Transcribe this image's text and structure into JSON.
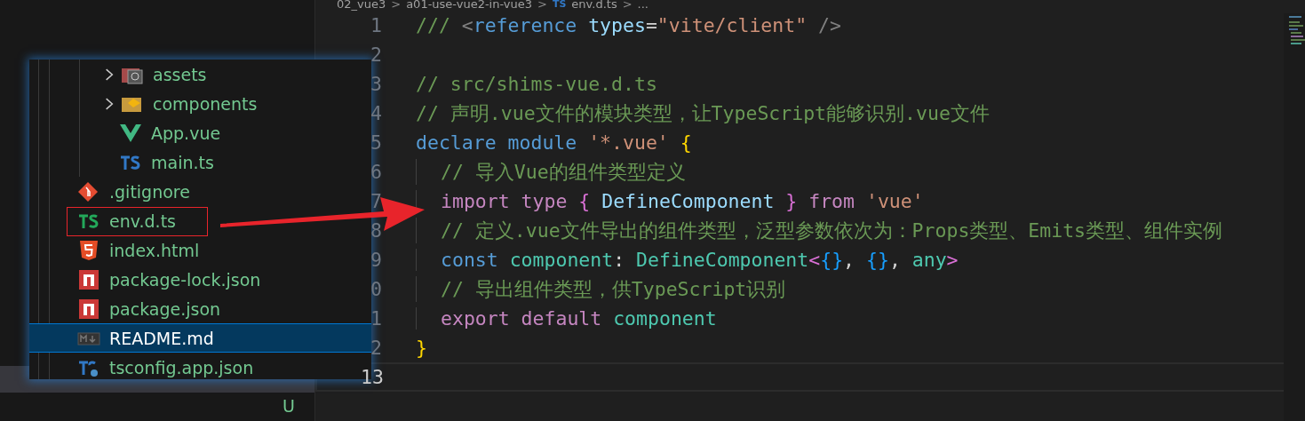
{
  "breadcrumb": [
    {
      "kind": "crumb",
      "text": "02_vue3"
    },
    {
      "kind": "sep",
      "text": ">"
    },
    {
      "kind": "crumb",
      "text": "a01-use-vue2-in-vue3"
    },
    {
      "kind": "sep",
      "text": ">"
    },
    {
      "kind": "badge",
      "text": "TS"
    },
    {
      "kind": "crumb",
      "text": "env.d.ts"
    },
    {
      "kind": "sep",
      "text": ">"
    },
    {
      "kind": "crumb",
      "text": "..."
    }
  ],
  "sidebar": {
    "git_badges": [
      "U"
    ]
  },
  "file_popup": {
    "items": [
      {
        "kind": "group",
        "children": [
          {
            "kind": "assets-folder",
            "label": "assets",
            "selected": false
          },
          {
            "kind": "components-folder",
            "label": "components",
            "selected": false
          },
          {
            "kind": "vue",
            "label": "App.vue",
            "selected": false
          },
          {
            "kind": "ts",
            "label": "main.ts",
            "selected": false
          }
        ]
      },
      {
        "kind": "git",
        "label": ".gitignore",
        "selected": false
      },
      {
        "kind": "ts-green",
        "label": "env.d.ts",
        "selected": false,
        "annotated": true
      },
      {
        "kind": "html",
        "label": "index.html",
        "selected": false
      },
      {
        "kind": "npm",
        "label": "package-lock.json",
        "selected": false
      },
      {
        "kind": "npm",
        "label": "package.json",
        "selected": false
      },
      {
        "kind": "md",
        "label": "README.md",
        "selected": true
      },
      {
        "kind": "ts-config",
        "label": "tsconfig.app.json",
        "selected": false
      }
    ]
  },
  "editor": {
    "lines": [
      {
        "number": "1",
        "indent": false,
        "current": false,
        "tokens": [
          {
            "t": "///",
            "color": "#6a9955"
          },
          {
            "t": " <",
            "color": "#808080"
          },
          {
            "t": "reference",
            "color": "#569cd6"
          },
          {
            "t": " types",
            "color": "#9cdcfe"
          },
          {
            "t": "=",
            "color": "#d4d4d4"
          },
          {
            "t": "\"vite/client\"",
            "color": "#ce9178"
          },
          {
            "t": " />",
            "color": "#808080"
          }
        ]
      },
      {
        "number": "2",
        "indent": false,
        "current": false
      },
      {
        "number": "3",
        "indent": false,
        "current": false,
        "tokens": [
          {
            "t": "// src/shims-vue.d.ts",
            "color": "#6a9955"
          }
        ]
      },
      {
        "number": "4",
        "indent": false,
        "current": false,
        "tokens": [
          {
            "t": "// 声明.vue文件的模块类型，让TypeScript能够识别.vue文件",
            "color": "#6a9955"
          }
        ]
      },
      {
        "number": "5",
        "indent": false,
        "current": false,
        "tokens": [
          {
            "t": "declare module",
            "color": "#569cd6"
          },
          {
            "t": " '*.vue'",
            "color": "#ce9178"
          },
          {
            "t": " {",
            "color": "#ffd700"
          }
        ]
      },
      {
        "number": "6",
        "indent": true,
        "current": false,
        "tokens": [
          {
            "t": "// 导入Vue的组件类型定义",
            "color": "#6a9955"
          }
        ]
      },
      {
        "number": "7",
        "indent": true,
        "current": false,
        "tokens": [
          {
            "t": "import type",
            "color": "#c586c0"
          },
          {
            "t": " {",
            "color": "#da70d6"
          },
          {
            "t": " DefineComponent",
            "color": "#9cdcfe"
          },
          {
            "t": " }",
            "color": "#da70d6"
          },
          {
            "t": " from",
            "color": "#c586c0"
          },
          {
            "t": " 'vue'",
            "color": "#ce9178"
          }
        ]
      },
      {
        "number": "8",
        "indent": true,
        "current": false,
        "tokens": [
          {
            "t": "// 定义.vue文件导出的组件类型，泛型参数依次为：Props类型、Emits类型、组件实例",
            "color": "#6a9955"
          }
        ]
      },
      {
        "number": "9",
        "indent": true,
        "current": false,
        "tokens": [
          {
            "t": "const",
            "color": "#569cd6"
          },
          {
            "t": " component",
            "color": "#4ec9b0"
          },
          {
            "t": ": ",
            "color": "#d4d4d4"
          },
          {
            "t": "DefineComponent",
            "color": "#4ec9b0"
          },
          {
            "t": "<",
            "color": "#da70d6"
          },
          {
            "t": "{}",
            "color": "#179fff"
          },
          {
            "t": ", ",
            "color": "#d4d4d4"
          },
          {
            "t": "{}",
            "color": "#179fff"
          },
          {
            "t": ", ",
            "color": "#d4d4d4"
          },
          {
            "t": "any",
            "color": "#4ec9b0"
          },
          {
            "t": ">",
            "color": "#da70d6"
          }
        ]
      },
      {
        "number": "0",
        "indent": true,
        "current": false,
        "tokens": [
          {
            "t": "// 导出组件类型，供TypeScript识别",
            "color": "#6a9955"
          }
        ]
      },
      {
        "number": "1",
        "indent": true,
        "current": false,
        "tokens": [
          {
            "t": "export default",
            "color": "#c586c0"
          },
          {
            "t": " component",
            "color": "#4ec9b0"
          }
        ]
      },
      {
        "number": "2",
        "indent": false,
        "current": false,
        "tokens": [
          {
            "t": "}",
            "color": "#ffd700"
          }
        ]
      },
      {
        "number": "13",
        "indent": false,
        "current": true
      }
    ]
  }
}
